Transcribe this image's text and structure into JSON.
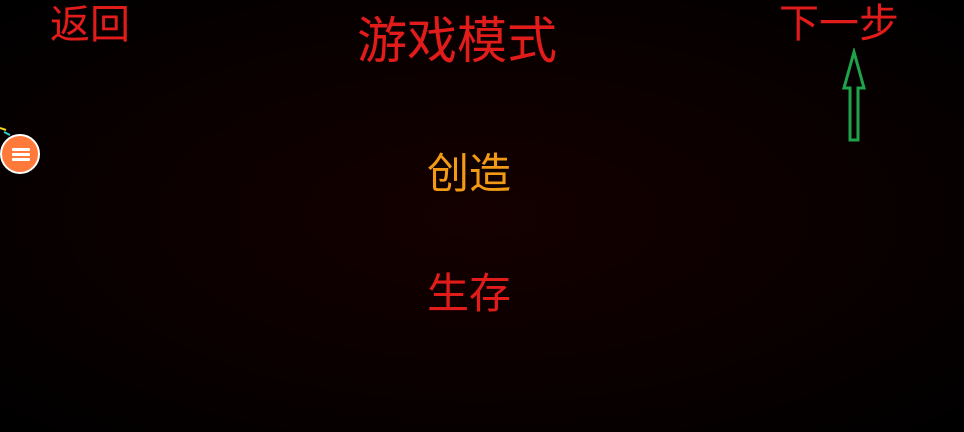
{
  "header": {
    "back_label": "返回",
    "title": "游戏模式",
    "next_label": "下一步"
  },
  "modes": {
    "creative_label": "创造",
    "survival_label": "生存"
  },
  "overlay": {
    "menu_icon": "menu-icon",
    "hint_icon": "arrow-up-icon",
    "accent_color": "#ff7a3a"
  },
  "colors": {
    "background": "#000000",
    "primary_text": "#e21b1b",
    "selected_mode": "#f29a16",
    "hint_arrow": "#1fa34a"
  }
}
